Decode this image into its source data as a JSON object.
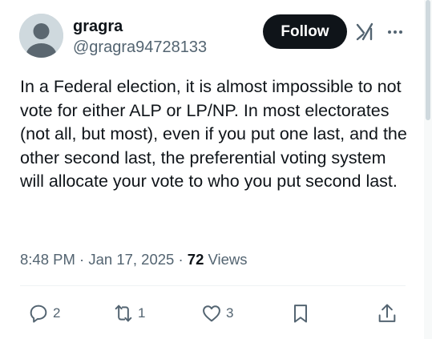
{
  "author": {
    "name": "gragra",
    "handle": "@gragra94728133"
  },
  "header": {
    "follow_label": "Follow",
    "grok_icon": "grok-icon",
    "more_icon": "more-icon"
  },
  "tweet": {
    "text": "In a Federal election, it is almost impossible to not vote for either ALP or LP/NP. In most electorates (not all, but most), even if you put one last, and the other second last, the preferential voting system will allocate your vote to who you put second last."
  },
  "meta": {
    "time": "8:48 PM",
    "separator": "·",
    "date": "Jan 17, 2025",
    "views_count": "72",
    "views_label": "Views"
  },
  "actions": {
    "replies": "2",
    "reposts": "1",
    "likes": "3"
  },
  "colors": {
    "text": "#0f1419",
    "secondary": "#536471",
    "follow_bg": "#0f1419",
    "divider": "#eff3f4"
  }
}
